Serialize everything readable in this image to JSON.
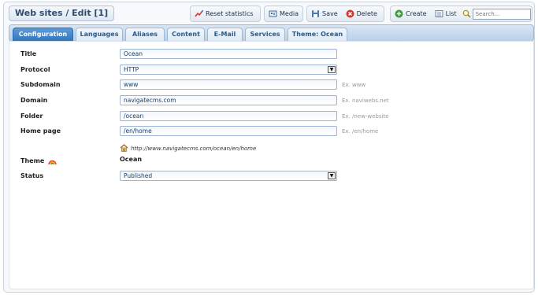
{
  "header": {
    "title": "Web sites / Edit [1]"
  },
  "toolbar": {
    "reset_label": "Reset statistics",
    "media_label": "Media",
    "save_label": "Save",
    "delete_label": "Delete",
    "create_label": "Create",
    "list_label": "List",
    "search_placeholder": "Search..."
  },
  "tabs": [
    {
      "label": "Configuration",
      "active": true
    },
    {
      "label": "Languages"
    },
    {
      "label": "Aliases"
    },
    {
      "label": "Content"
    },
    {
      "label": "E-Mail"
    },
    {
      "label": "Services"
    },
    {
      "label": "Theme: Ocean"
    }
  ],
  "form": {
    "title": {
      "label": "Title",
      "value": "Ocean"
    },
    "protocol": {
      "label": "Protocol",
      "value": "HTTP"
    },
    "subdomain": {
      "label": "Subdomain",
      "value": "www",
      "hint": "Ex. www"
    },
    "domain": {
      "label": "Domain",
      "value": "navigatecms.com",
      "hint": "Ex. naviwebs.net"
    },
    "folder": {
      "label": "Folder",
      "value": "/ocean",
      "hint": "Ex. /new-website"
    },
    "homepage": {
      "label": "Home page",
      "value": "/en/home",
      "hint": "Ex. /en/home"
    },
    "url_preview": "http://www.navigatecms.com/ocean/en/home",
    "theme": {
      "label": "Theme",
      "value": "Ocean"
    },
    "status": {
      "label": "Status",
      "value": "Published"
    }
  },
  "icons": {
    "reset": "chart-reset-icon",
    "media": "media-icon",
    "save": "floppy-save-icon",
    "delete": "delete-icon",
    "create": "create-plus-icon",
    "list": "list-icon",
    "search": "magnifier-icon",
    "home": "home-icon",
    "theme": "rainbow-icon"
  },
  "colors": {
    "active_tab": "#2f74bd",
    "tab_text": "#2a5a8e",
    "field_text": "#1a3e6b",
    "delete_red": "#d9342b",
    "create_green": "#3a9a35"
  }
}
